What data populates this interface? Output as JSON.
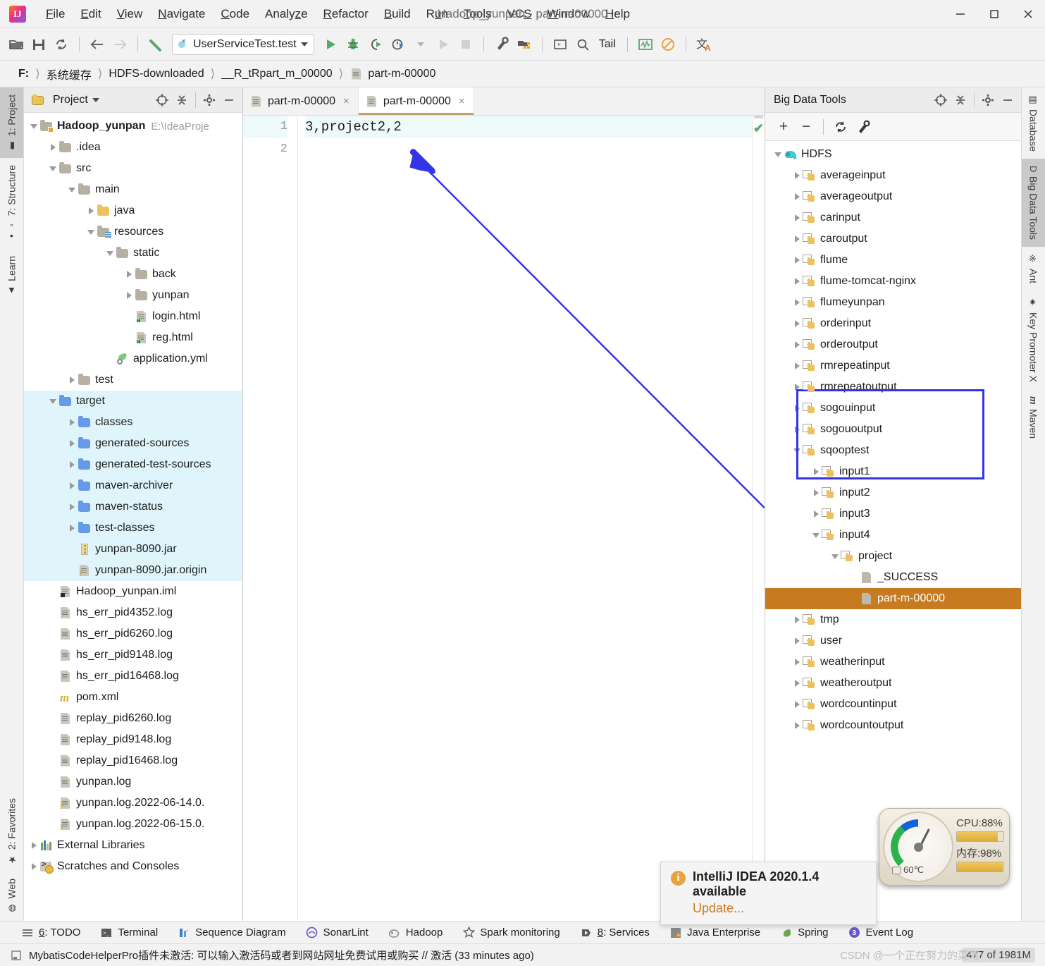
{
  "window": {
    "title": "Hadoop_yunpan - part-m-00000",
    "minimize_label": "Minimize",
    "maximize_label": "Maximize",
    "close_label": "Close"
  },
  "menubar": {
    "items": [
      {
        "label": "File",
        "mnemonic": "F"
      },
      {
        "label": "Edit",
        "mnemonic": "E"
      },
      {
        "label": "View",
        "mnemonic": "V"
      },
      {
        "label": "Navigate",
        "mnemonic": "N"
      },
      {
        "label": "Code",
        "mnemonic": "C"
      },
      {
        "label": "Analyze",
        "mnemonic": "z"
      },
      {
        "label": "Refactor",
        "mnemonic": "R"
      },
      {
        "label": "Build",
        "mnemonic": "B"
      },
      {
        "label": "Run",
        "mnemonic": "u"
      },
      {
        "label": "Tools",
        "mnemonic": "T"
      },
      {
        "label": "VCS",
        "mnemonic": "S"
      },
      {
        "label": "Window",
        "mnemonic": "W"
      },
      {
        "label": "Help",
        "mnemonic": "H"
      }
    ]
  },
  "toolbar": {
    "open_label": "Open",
    "save_label": "Save All",
    "sync_label": "Synchronize",
    "back_label": "Back",
    "forward_label": "Forward",
    "build_label": "Build Project",
    "run_config": "UserServiceTest.test",
    "run_label": "Run",
    "debug_label": "Debug",
    "run_coverage_label": "Run with Coverage",
    "profile_label": "Profile",
    "run_dim_label": "Run",
    "stop_label": "Stop",
    "settings_label": "Settings",
    "project_structure_label": "Project Structure",
    "terminal_label": "Terminal",
    "search_label": "Search Everywhere",
    "tail_label": "Tail",
    "monitoring_label": "Monitoring",
    "suppress_label": "Suppress",
    "translate_label": "Translate"
  },
  "breadcrumb": {
    "items": [
      "F:",
      "系统缓存",
      "HDFS-downloaded",
      "__R_tRpart_m_00000",
      "part-m-00000"
    ]
  },
  "left_stripe": {
    "tabs": [
      {
        "label": "1: Project",
        "active": true
      },
      {
        "label": "7: Structure",
        "active": false
      },
      {
        "label": "Learn",
        "active": false
      }
    ],
    "bottom_tabs": [
      {
        "label": "2: Favorites",
        "active": false
      },
      {
        "label": "Web",
        "active": false
      }
    ]
  },
  "right_stripe": {
    "tabs": [
      {
        "label": "Database",
        "active": false
      },
      {
        "label": "Big Data Tools",
        "active": true
      },
      {
        "label": "Ant",
        "active": false
      },
      {
        "label": "Key Promoter X",
        "active": false
      },
      {
        "label": "Maven",
        "active": false
      }
    ]
  },
  "project_panel": {
    "title": "Project",
    "select_opened_file_label": "Select Opened File",
    "collapse_all_label": "Collapse All",
    "settings_label": "Settings",
    "hide_label": "Hide",
    "tree": [
      {
        "label": "Hadoop_yunpan",
        "note": "E:\\IdeaProje",
        "indent": 0,
        "arrow": "down",
        "icon": "folder-module",
        "bold": true
      },
      {
        "label": ".idea",
        "indent": 1,
        "arrow": "right",
        "icon": "folder-grey"
      },
      {
        "label": "src",
        "indent": 1,
        "arrow": "down",
        "icon": "folder-grey"
      },
      {
        "label": "main",
        "indent": 2,
        "arrow": "down",
        "icon": "folder-grey"
      },
      {
        "label": "java",
        "indent": 3,
        "arrow": "right",
        "icon": "folder-source"
      },
      {
        "label": "resources",
        "indent": 3,
        "arrow": "down",
        "icon": "folder-resource"
      },
      {
        "label": "static",
        "indent": 4,
        "arrow": "down",
        "icon": "folder-grey"
      },
      {
        "label": "back",
        "indent": 5,
        "arrow": "right",
        "icon": "folder-grey"
      },
      {
        "label": "yunpan",
        "indent": 5,
        "arrow": "right",
        "icon": "folder-grey"
      },
      {
        "label": "login.html",
        "indent": 5,
        "arrow": "none",
        "icon": "file-html"
      },
      {
        "label": "reg.html",
        "indent": 5,
        "arrow": "none",
        "icon": "file-html"
      },
      {
        "label": "application.yml",
        "indent": 4,
        "arrow": "none",
        "icon": "file-yml"
      },
      {
        "label": "test",
        "indent": 2,
        "arrow": "right",
        "icon": "folder-grey"
      },
      {
        "label": "target",
        "indent": 1,
        "arrow": "down",
        "icon": "folder-blue",
        "highlight": true
      },
      {
        "label": "classes",
        "indent": 2,
        "arrow": "right",
        "icon": "folder-blue",
        "highlight": true
      },
      {
        "label": "generated-sources",
        "indent": 2,
        "arrow": "right",
        "icon": "folder-blue",
        "highlight": true
      },
      {
        "label": "generated-test-sources",
        "indent": 2,
        "arrow": "right",
        "icon": "folder-blue",
        "highlight": true
      },
      {
        "label": "maven-archiver",
        "indent": 2,
        "arrow": "right",
        "icon": "folder-blue",
        "highlight": true
      },
      {
        "label": "maven-status",
        "indent": 2,
        "arrow": "right",
        "icon": "folder-blue",
        "highlight": true
      },
      {
        "label": "test-classes",
        "indent": 2,
        "arrow": "right",
        "icon": "folder-blue",
        "highlight": true
      },
      {
        "label": "yunpan-8090.jar",
        "indent": 2,
        "arrow": "none",
        "icon": "file-jar",
        "highlight": true
      },
      {
        "label": "yunpan-8090.jar.origin",
        "indent": 2,
        "arrow": "none",
        "icon": "file-unknown",
        "highlight": true
      },
      {
        "label": "Hadoop_yunpan.iml",
        "indent": 1,
        "arrow": "none",
        "icon": "file-iml"
      },
      {
        "label": "hs_err_pid4352.log",
        "indent": 1,
        "arrow": "none",
        "icon": "file-log"
      },
      {
        "label": "hs_err_pid6260.log",
        "indent": 1,
        "arrow": "none",
        "icon": "file-log"
      },
      {
        "label": "hs_err_pid9148.log",
        "indent": 1,
        "arrow": "none",
        "icon": "file-log"
      },
      {
        "label": "hs_err_pid16468.log",
        "indent": 1,
        "arrow": "none",
        "icon": "file-log"
      },
      {
        "label": "pom.xml",
        "indent": 1,
        "arrow": "none",
        "icon": "file-maven"
      },
      {
        "label": "replay_pid6260.log",
        "indent": 1,
        "arrow": "none",
        "icon": "file-log"
      },
      {
        "label": "replay_pid9148.log",
        "indent": 1,
        "arrow": "none",
        "icon": "file-log"
      },
      {
        "label": "replay_pid16468.log",
        "indent": 1,
        "arrow": "none",
        "icon": "file-log"
      },
      {
        "label": "yunpan.log",
        "indent": 1,
        "arrow": "none",
        "icon": "file-log"
      },
      {
        "label": "yunpan.log.2022-06-14.0.",
        "indent": 1,
        "arrow": "none",
        "icon": "file-unknown"
      },
      {
        "label": "yunpan.log.2022-06-15.0.",
        "indent": 1,
        "arrow": "none",
        "icon": "file-unknown"
      },
      {
        "label": "External Libraries",
        "indent": 0,
        "arrow": "right",
        "icon": "libraries"
      },
      {
        "label": "Scratches and Consoles",
        "indent": 0,
        "arrow": "right",
        "icon": "scratches"
      }
    ]
  },
  "editor": {
    "tabs": [
      {
        "label": "part-m-00000",
        "active": false,
        "close": "×"
      },
      {
        "label": "part-m-00000",
        "active": true,
        "close": "×"
      }
    ],
    "line_numbers": [
      "1",
      "2"
    ],
    "lines": [
      "3,project2,2",
      ""
    ],
    "inspection_status": "✔"
  },
  "bigdata_panel": {
    "title": "Big Data Tools",
    "locate_label": "Locate",
    "collapse_all_label": "Collapse All",
    "settings_label": "Settings",
    "hide_label": "Hide",
    "add_label": "+",
    "remove_label": "−",
    "refresh_label": "Refresh",
    "configure_label": "Configure",
    "tree": [
      {
        "label": "HDFS",
        "indent": 0,
        "arrow": "down",
        "icon": "hadoop"
      },
      {
        "label": "averageinput",
        "indent": 1,
        "arrow": "right",
        "icon": "hdfs-folder"
      },
      {
        "label": "averageoutput",
        "indent": 1,
        "arrow": "right",
        "icon": "hdfs-folder"
      },
      {
        "label": "carinput",
        "indent": 1,
        "arrow": "right",
        "icon": "hdfs-folder"
      },
      {
        "label": "caroutput",
        "indent": 1,
        "arrow": "right",
        "icon": "hdfs-folder"
      },
      {
        "label": "flume",
        "indent": 1,
        "arrow": "right",
        "icon": "hdfs-folder"
      },
      {
        "label": "flume-tomcat-nginx",
        "indent": 1,
        "arrow": "right",
        "icon": "hdfs-folder"
      },
      {
        "label": "flumeyunpan",
        "indent": 1,
        "arrow": "right",
        "icon": "hdfs-folder"
      },
      {
        "label": "orderinput",
        "indent": 1,
        "arrow": "right",
        "icon": "hdfs-folder"
      },
      {
        "label": "orderoutput",
        "indent": 1,
        "arrow": "right",
        "icon": "hdfs-folder"
      },
      {
        "label": "rmrepeatinput",
        "indent": 1,
        "arrow": "right",
        "icon": "hdfs-folder"
      },
      {
        "label": "rmrepeatoutput",
        "indent": 1,
        "arrow": "right",
        "icon": "hdfs-folder"
      },
      {
        "label": "sogouinput",
        "indent": 1,
        "arrow": "right",
        "icon": "hdfs-folder"
      },
      {
        "label": "sogououtput",
        "indent": 1,
        "arrow": "right",
        "icon": "hdfs-folder"
      },
      {
        "label": "sqooptest",
        "indent": 1,
        "arrow": "down",
        "icon": "hdfs-folder"
      },
      {
        "label": "input1",
        "indent": 2,
        "arrow": "right",
        "icon": "hdfs-folder"
      },
      {
        "label": "input2",
        "indent": 2,
        "arrow": "right",
        "icon": "hdfs-folder"
      },
      {
        "label": "input3",
        "indent": 2,
        "arrow": "right",
        "icon": "hdfs-folder"
      },
      {
        "label": "input4",
        "indent": 2,
        "arrow": "down",
        "icon": "hdfs-folder"
      },
      {
        "label": "project",
        "indent": 3,
        "arrow": "down",
        "icon": "hdfs-folder"
      },
      {
        "label": "_SUCCESS",
        "indent": 4,
        "arrow": "none",
        "icon": "hdfs-file"
      },
      {
        "label": "part-m-00000",
        "indent": 4,
        "arrow": "none",
        "icon": "hdfs-file",
        "selected": true
      },
      {
        "label": "tmp",
        "indent": 1,
        "arrow": "right",
        "icon": "hdfs-folder"
      },
      {
        "label": "user",
        "indent": 1,
        "arrow": "right",
        "icon": "hdfs-folder"
      },
      {
        "label": "weatherinput",
        "indent": 1,
        "arrow": "right",
        "icon": "hdfs-folder"
      },
      {
        "label": "weatheroutput",
        "indent": 1,
        "arrow": "right",
        "icon": "hdfs-folder"
      },
      {
        "label": "wordcountinput",
        "indent": 1,
        "arrow": "right",
        "icon": "hdfs-folder"
      },
      {
        "label": "wordcountoutput",
        "indent": 1,
        "arrow": "right",
        "icon": "hdfs-folder"
      }
    ]
  },
  "gauge": {
    "cpu_label": "CPU:88%",
    "cpu_percent": 88,
    "mem_label": "内存:98%",
    "mem_percent": 98,
    "temp_label": "60℃"
  },
  "notification": {
    "title": "IntelliJ IDEA 2020.1.4 available",
    "action": "Update..."
  },
  "toolwindow_bar": {
    "items": [
      {
        "label": "6: TODO",
        "mnemonic": "6",
        "icon": "todo-icon"
      },
      {
        "label": "Terminal",
        "icon": "terminal-icon"
      },
      {
        "label": "Sequence Diagram",
        "icon": "sequence-diagram-icon"
      },
      {
        "label": "SonarLint",
        "icon": "sonarlint-icon"
      },
      {
        "label": "Hadoop",
        "icon": "hadoop-icon"
      },
      {
        "label": "Spark monitoring",
        "icon": "star-icon"
      },
      {
        "label": "8: Services",
        "mnemonic": "8",
        "icon": "services-icon"
      },
      {
        "label": "Java Enterprise",
        "icon": "java-enterprise-icon"
      },
      {
        "label": "Spring",
        "icon": "spring-icon"
      },
      {
        "label": "Event Log",
        "icon": "event-log-icon",
        "badge": "3"
      }
    ]
  },
  "statusbar": {
    "message": "MybatisCodeHelperPro插件未激活: 可以输入激活码或者到网站网址免费试用或购买 // 激活 (33 minutes ago)",
    "watermark": "CSDN @一个正在努力的菜鸟",
    "memory": "477 of 1981M"
  }
}
